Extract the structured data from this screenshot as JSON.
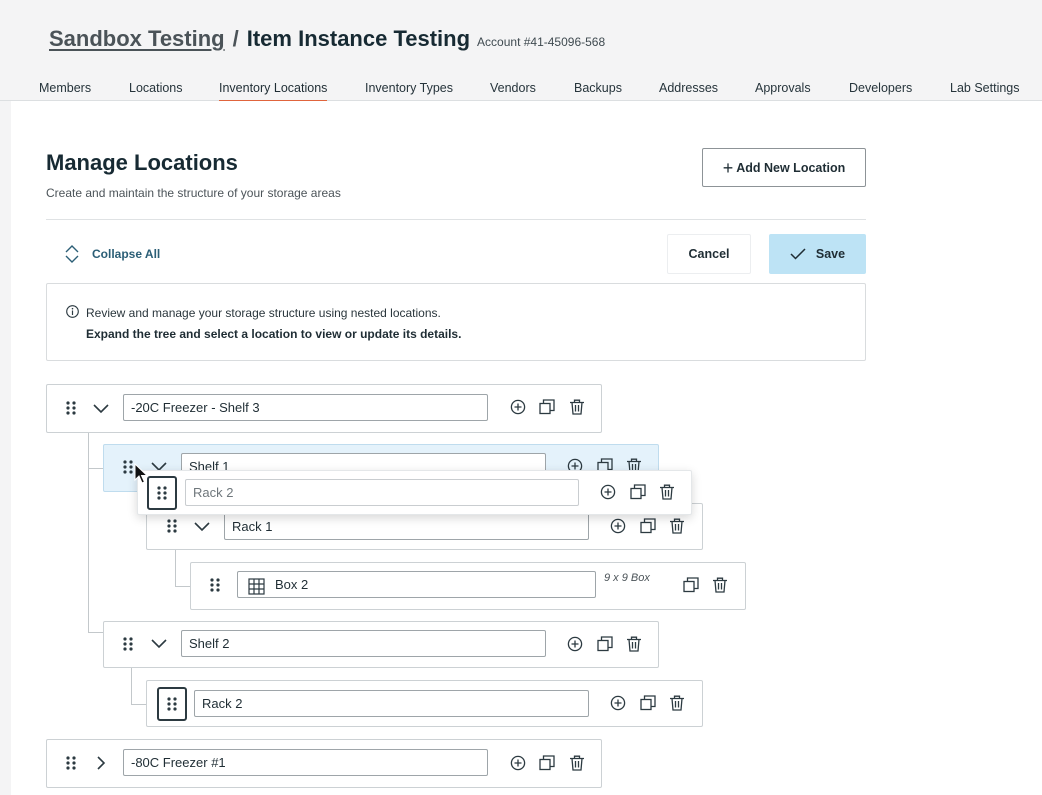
{
  "breadcrumb": {
    "parent": "Sandbox Testing",
    "separator": "/",
    "current": "Item Instance Testing",
    "account": "Account #41-45096-568"
  },
  "tabs": [
    {
      "label": "Members"
    },
    {
      "label": "Locations"
    },
    {
      "label": "Inventory Locations",
      "active": true
    },
    {
      "label": "Inventory Types"
    },
    {
      "label": "Vendors"
    },
    {
      "label": "Backups"
    },
    {
      "label": "Addresses"
    },
    {
      "label": "Approvals"
    },
    {
      "label": "Developers"
    },
    {
      "label": "Lab Settings"
    }
  ],
  "page": {
    "title": "Manage Locations",
    "subtitle": "Create and maintain the structure of your storage areas",
    "add_button": "Add New Location",
    "collapse_all": "Collapse All",
    "cancel": "Cancel",
    "save": "Save"
  },
  "info": {
    "line1": "Review and manage your storage structure using nested locations.",
    "line2": "Expand the tree and select a location to view or update its details."
  },
  "tree": {
    "freezer_shelf3": "-20C Freezer - Shelf 3",
    "shelf1": "Shelf 1",
    "rack1": "Rack 1",
    "box2": "Box 2",
    "box2_dims": "9 x 9 Box",
    "shelf2": "Shelf 2",
    "rack2": "Rack 2",
    "freezer_80": "-80C Freezer #1"
  },
  "dragging": {
    "label": "Rack 2"
  },
  "colors": {
    "active_tab_underline": "#e0643c",
    "save_bg": "#bde3f5",
    "selected_row_bg": "#e4f2fb",
    "link": "#2b5e76"
  },
  "icons": {
    "drag": "drag-handle-icon",
    "expand": "chevron-down-icon",
    "collapsed": "chevron-right-icon",
    "add": "add-circle-icon",
    "copy": "copy-icon",
    "delete": "trash-icon",
    "grid": "grid-icon",
    "info": "info-icon",
    "collapse_all": "collapse-icon",
    "check": "check-icon"
  }
}
